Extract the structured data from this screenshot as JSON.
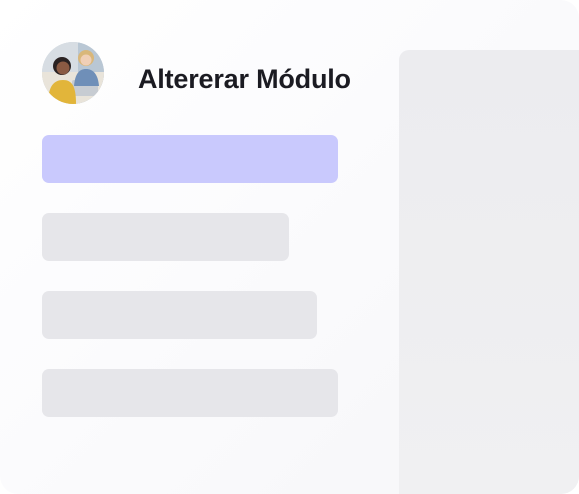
{
  "header": {
    "title": "Altererar Módulo",
    "avatar_icon": "user-avatar-photo"
  },
  "form": {
    "fields": [
      {
        "state": "selected",
        "color": "#c9c9fd"
      },
      {
        "state": "placeholder",
        "color": "#e6e6ea"
      },
      {
        "state": "placeholder",
        "color": "#e6e6ea"
      },
      {
        "state": "placeholder",
        "color": "#e6e6ea"
      }
    ]
  },
  "colors": {
    "accent": "#c9c9fd",
    "panel": "#ececef",
    "text": "#1b1b22"
  }
}
